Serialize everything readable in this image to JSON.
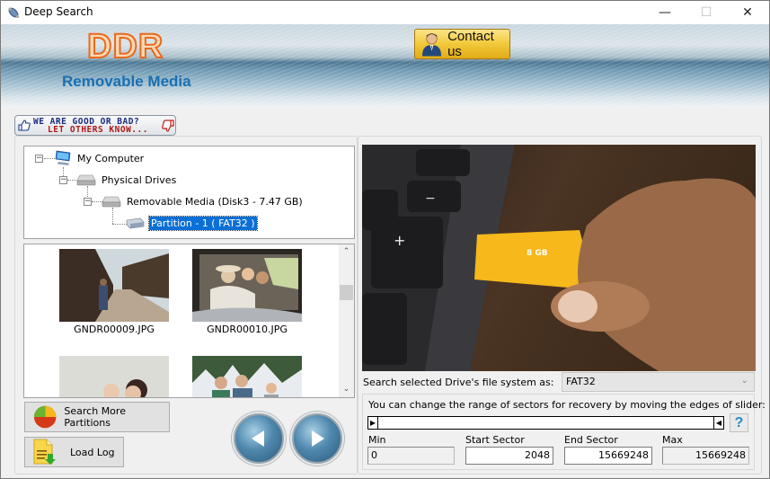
{
  "window": {
    "title": "Deep Search",
    "controls": {
      "minimize": "—",
      "maximize": "☐",
      "close": "✕"
    }
  },
  "banner": {
    "logo": "DDR",
    "product": "Removable Media",
    "contact_label": "Contact us"
  },
  "rating": {
    "line1": "WE ARE GOOD OR BAD?",
    "line2": "LET OTHERS KNOW..."
  },
  "tree": {
    "nodes": [
      {
        "label": "My Computer",
        "icon": "computer-icon",
        "expanded": true
      },
      {
        "label": "Physical Drives",
        "icon": "drive-icon",
        "expanded": true
      },
      {
        "label": "Removable Media (Disk3 - 7.47 GB)",
        "icon": "drive-icon",
        "expanded": true
      },
      {
        "label": "Partition - 1 ( FAT32 )",
        "icon": "partition-icon",
        "selected": true
      }
    ]
  },
  "thumbnails": [
    {
      "filename": "GNDR00009.JPG"
    },
    {
      "filename": "GNDR00010.JPG"
    },
    {
      "filename": ""
    },
    {
      "filename": ""
    }
  ],
  "buttons": {
    "search_more": "Search More Partitions",
    "load_log": "Load Log",
    "prev": "previous",
    "next": "next"
  },
  "filesystem": {
    "label": "Search selected Drive's file system as:",
    "selected": "FAT32"
  },
  "sectors": {
    "hint": "You can change the range of sectors for recovery by moving the edges of slider:",
    "help": "?",
    "min_label": "Min",
    "min_value": "0",
    "start_label": "Start Sector",
    "start_value": "2048",
    "end_label": "End Sector",
    "end_value": "15669248",
    "max_label": "Max",
    "max_value": "15669248"
  }
}
